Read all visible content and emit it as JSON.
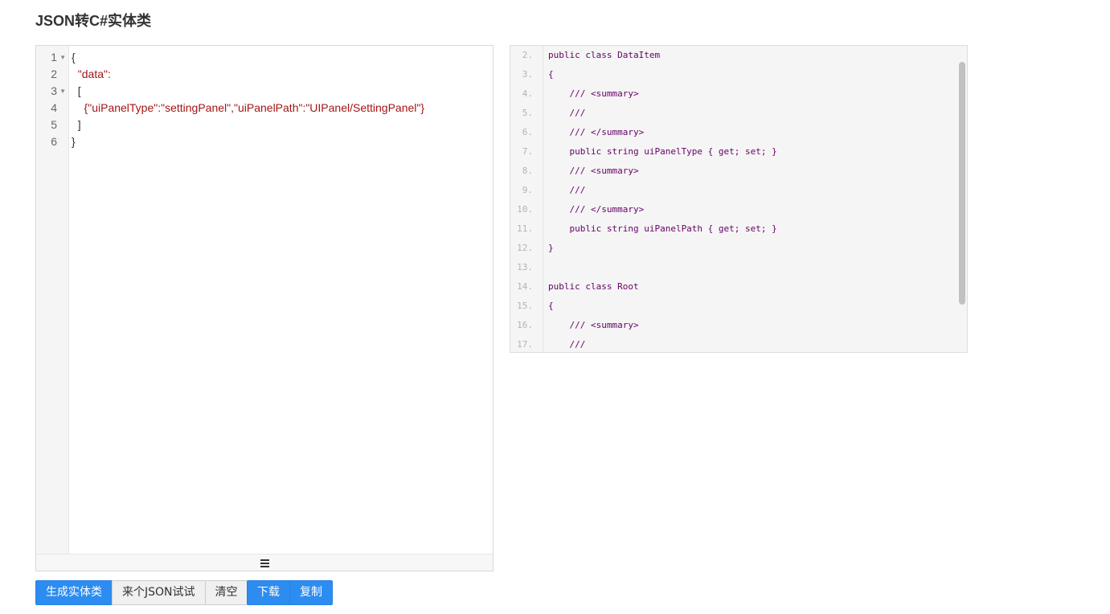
{
  "page": {
    "title": "JSON转C#实体类"
  },
  "json_editor": {
    "line_numbers": [
      "1",
      "2",
      "3",
      "4",
      "5",
      "6"
    ],
    "lines": [
      "{",
      "  \"data\":",
      "  [",
      "    {\"uiPanelType\":\"settingPanel\",\"uiPanelPath\":\"UIPanel/SettingPanel\"}",
      "  ]",
      "}"
    ]
  },
  "cs_output": {
    "lines": [
      {
        "num": "2.",
        "text": "public class DataItem"
      },
      {
        "num": "3.",
        "text": "{"
      },
      {
        "num": "4.",
        "text": "    /// <summary>"
      },
      {
        "num": "5.",
        "text": "    ///"
      },
      {
        "num": "6.",
        "text": "    /// </summary>"
      },
      {
        "num": "7.",
        "text": "    public string uiPanelType { get; set; }"
      },
      {
        "num": "8.",
        "text": "    /// <summary>"
      },
      {
        "num": "9.",
        "text": "    ///"
      },
      {
        "num": "10.",
        "text": "    /// </summary>"
      },
      {
        "num": "11.",
        "text": "    public string uiPanelPath { get; set; }"
      },
      {
        "num": "12.",
        "text": "}"
      },
      {
        "num": "13.",
        "text": ""
      },
      {
        "num": "14.",
        "text": "public class Root"
      },
      {
        "num": "15.",
        "text": "{"
      },
      {
        "num": "16.",
        "text": "    /// <summary>"
      },
      {
        "num": "17.",
        "text": "    ///"
      }
    ]
  },
  "buttons": {
    "generate": "生成实体类",
    "try_json": "来个JSON试试",
    "clear": "清空",
    "download": "下载",
    "copy": "复制"
  },
  "colors": {
    "primary": "#2d8cf0",
    "json_string": "#a31515",
    "cs_keyword": "#660066",
    "line_number": "#b3b3b3"
  }
}
